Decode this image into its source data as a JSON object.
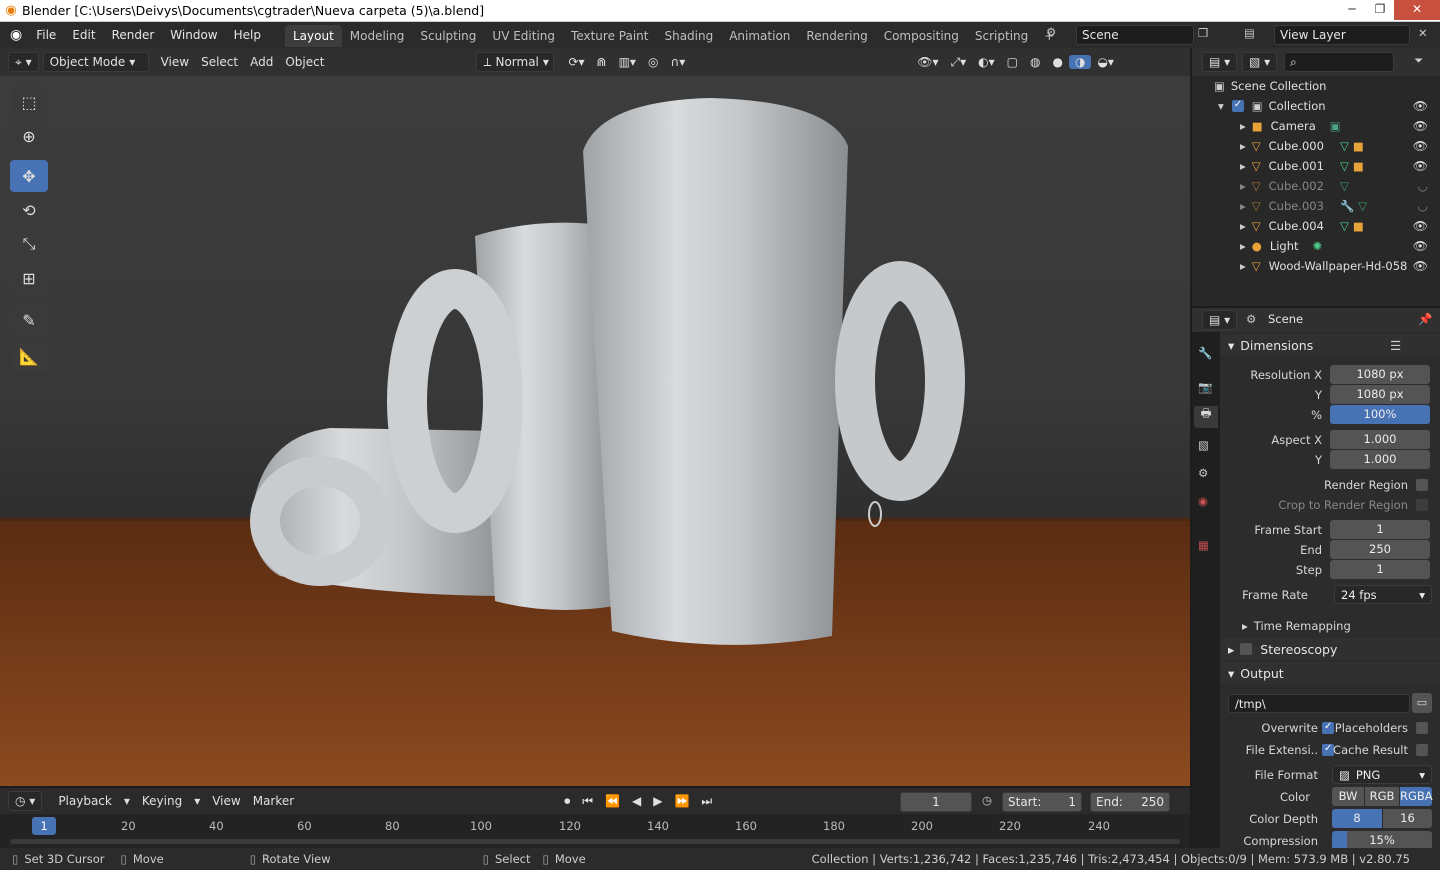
{
  "window": {
    "title": "Blender [C:\\Users\\Deivys\\Documents\\cgtrader\\Nueva carpeta (5)\\a.blend]"
  },
  "menus": [
    "File",
    "Edit",
    "Render",
    "Window",
    "Help"
  ],
  "workspaces": [
    "Layout",
    "Modeling",
    "Sculpting",
    "UV Editing",
    "Texture Paint",
    "Shading",
    "Animation",
    "Rendering",
    "Compositing",
    "Scripting"
  ],
  "scene_name": "Scene",
  "view_layer": "View Layer",
  "viewport_header": {
    "mode": "Object Mode",
    "menus": [
      "View",
      "Select",
      "Add",
      "Object"
    ],
    "orientation": "Normal"
  },
  "outliner": {
    "scene_collection": "Scene Collection",
    "collection": "Collection",
    "items": [
      {
        "name": "Camera"
      },
      {
        "name": "Cube.000"
      },
      {
        "name": "Cube.001"
      },
      {
        "name": "Cube.002"
      },
      {
        "name": "Cube.003"
      },
      {
        "name": "Cube.004"
      },
      {
        "name": "Light"
      },
      {
        "name": "Wood-Wallpaper-Hd-058"
      }
    ]
  },
  "properties": {
    "context": "Scene",
    "dimensions": {
      "title": "Dimensions",
      "resolution_x_label": "Resolution X",
      "resolution_x": "1080 px",
      "y_label": "Y",
      "resolution_y": "1080 px",
      "pct_label": "%",
      "pct": "100%",
      "aspect_x_label": "Aspect X",
      "aspect_x": "1.000",
      "aspect_y": "1.000",
      "render_region": "Render Region",
      "crop": "Crop to Render Region",
      "frame_start_label": "Frame Start",
      "frame_start": "1",
      "end_label": "End",
      "end": "250",
      "step_label": "Step",
      "step": "1",
      "frame_rate_label": "Frame Rate",
      "frame_rate": "24 fps",
      "time_remapping": "Time Remapping"
    },
    "stereoscopy": "Stereoscopy",
    "output": {
      "title": "Output",
      "path": "/tmp\\",
      "overwrite": "Overwrite",
      "placeholders": "Placeholders",
      "file_ext": "File Extensi..",
      "cache_result": "Cache Result",
      "file_format_label": "File Format",
      "file_format": "PNG",
      "color_label": "Color",
      "color_opts": [
        "BW",
        "RGB",
        "RGBA"
      ],
      "color_depth_label": "Color Depth",
      "depth_opts": [
        "8",
        "16"
      ],
      "compression_label": "Compression",
      "compression": "15%"
    }
  },
  "timeline": {
    "menus": [
      "Playback",
      "Keying",
      "View",
      "Marker"
    ],
    "current_frame": "1",
    "start_label": "Start:",
    "start": "1",
    "end_label": "End:",
    "end": "250",
    "ticks": [
      "20",
      "40",
      "60",
      "80",
      "100",
      "120",
      "140",
      "160",
      "180",
      "200",
      "220",
      "240"
    ],
    "playhead": "1"
  },
  "status": {
    "left": [
      "Set 3D Cursor",
      "Move",
      "Rotate View",
      "Select",
      "Move"
    ],
    "right": "Collection | Verts:1,236,742 | Faces:1,235,746 | Tris:2,473,454 | Objects:0/9 | Mem: 573.9 MB | v2.80.75"
  }
}
